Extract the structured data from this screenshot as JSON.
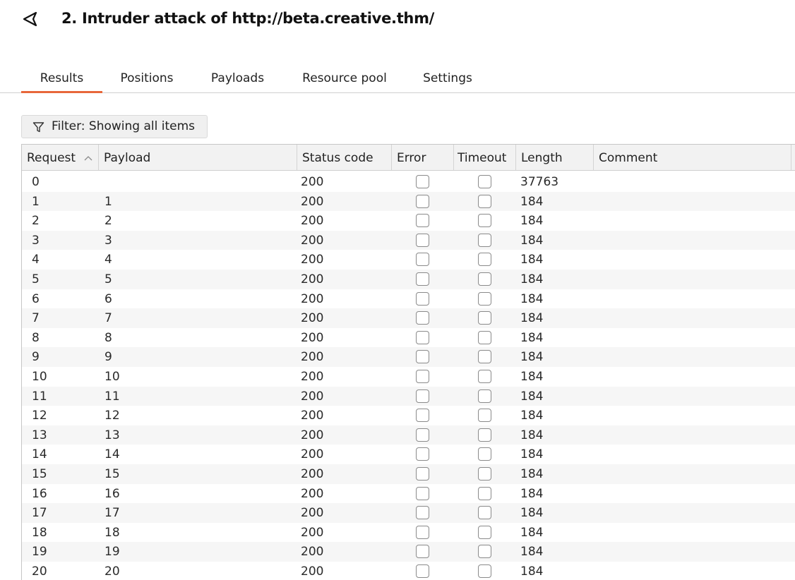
{
  "window": {
    "title": "2. Intruder attack of http://beta.creative.thm/",
    "back_icon": "back-arrow-icon"
  },
  "tabs": [
    {
      "label": "Results",
      "active": true
    },
    {
      "label": "Positions",
      "active": false
    },
    {
      "label": "Payloads",
      "active": false
    },
    {
      "label": "Resource pool",
      "active": false
    },
    {
      "label": "Settings",
      "active": false
    }
  ],
  "accent_color": "#e8673a",
  "filter": {
    "icon": "filter-funnel-icon",
    "label": "Filter: Showing all items"
  },
  "table": {
    "columns": [
      {
        "label": "Request",
        "sorted": "ascending"
      },
      {
        "label": "Payload"
      },
      {
        "label": "Status code"
      },
      {
        "label": "Error"
      },
      {
        "label": "Timeout"
      },
      {
        "label": "Length"
      },
      {
        "label": "Comment"
      }
    ],
    "rows": [
      {
        "request": "0",
        "payload": "",
        "status": "200",
        "error": false,
        "timeout": false,
        "length": "37763",
        "comment": ""
      },
      {
        "request": "1",
        "payload": "1",
        "status": "200",
        "error": false,
        "timeout": false,
        "length": "184",
        "comment": ""
      },
      {
        "request": "2",
        "payload": "2",
        "status": "200",
        "error": false,
        "timeout": false,
        "length": "184",
        "comment": ""
      },
      {
        "request": "3",
        "payload": "3",
        "status": "200",
        "error": false,
        "timeout": false,
        "length": "184",
        "comment": ""
      },
      {
        "request": "4",
        "payload": "4",
        "status": "200",
        "error": false,
        "timeout": false,
        "length": "184",
        "comment": ""
      },
      {
        "request": "5",
        "payload": "5",
        "status": "200",
        "error": false,
        "timeout": false,
        "length": "184",
        "comment": ""
      },
      {
        "request": "6",
        "payload": "6",
        "status": "200",
        "error": false,
        "timeout": false,
        "length": "184",
        "comment": ""
      },
      {
        "request": "7",
        "payload": "7",
        "status": "200",
        "error": false,
        "timeout": false,
        "length": "184",
        "comment": ""
      },
      {
        "request": "8",
        "payload": "8",
        "status": "200",
        "error": false,
        "timeout": false,
        "length": "184",
        "comment": ""
      },
      {
        "request": "9",
        "payload": "9",
        "status": "200",
        "error": false,
        "timeout": false,
        "length": "184",
        "comment": ""
      },
      {
        "request": "10",
        "payload": "10",
        "status": "200",
        "error": false,
        "timeout": false,
        "length": "184",
        "comment": ""
      },
      {
        "request": "11",
        "payload": "11",
        "status": "200",
        "error": false,
        "timeout": false,
        "length": "184",
        "comment": ""
      },
      {
        "request": "12",
        "payload": "12",
        "status": "200",
        "error": false,
        "timeout": false,
        "length": "184",
        "comment": ""
      },
      {
        "request": "13",
        "payload": "13",
        "status": "200",
        "error": false,
        "timeout": false,
        "length": "184",
        "comment": ""
      },
      {
        "request": "14",
        "payload": "14",
        "status": "200",
        "error": false,
        "timeout": false,
        "length": "184",
        "comment": ""
      },
      {
        "request": "15",
        "payload": "15",
        "status": "200",
        "error": false,
        "timeout": false,
        "length": "184",
        "comment": ""
      },
      {
        "request": "16",
        "payload": "16",
        "status": "200",
        "error": false,
        "timeout": false,
        "length": "184",
        "comment": ""
      },
      {
        "request": "17",
        "payload": "17",
        "status": "200",
        "error": false,
        "timeout": false,
        "length": "184",
        "comment": ""
      },
      {
        "request": "18",
        "payload": "18",
        "status": "200",
        "error": false,
        "timeout": false,
        "length": "184",
        "comment": ""
      },
      {
        "request": "19",
        "payload": "19",
        "status": "200",
        "error": false,
        "timeout": false,
        "length": "184",
        "comment": ""
      },
      {
        "request": "20",
        "payload": "20",
        "status": "200",
        "error": false,
        "timeout": false,
        "length": "184",
        "comment": ""
      }
    ]
  }
}
